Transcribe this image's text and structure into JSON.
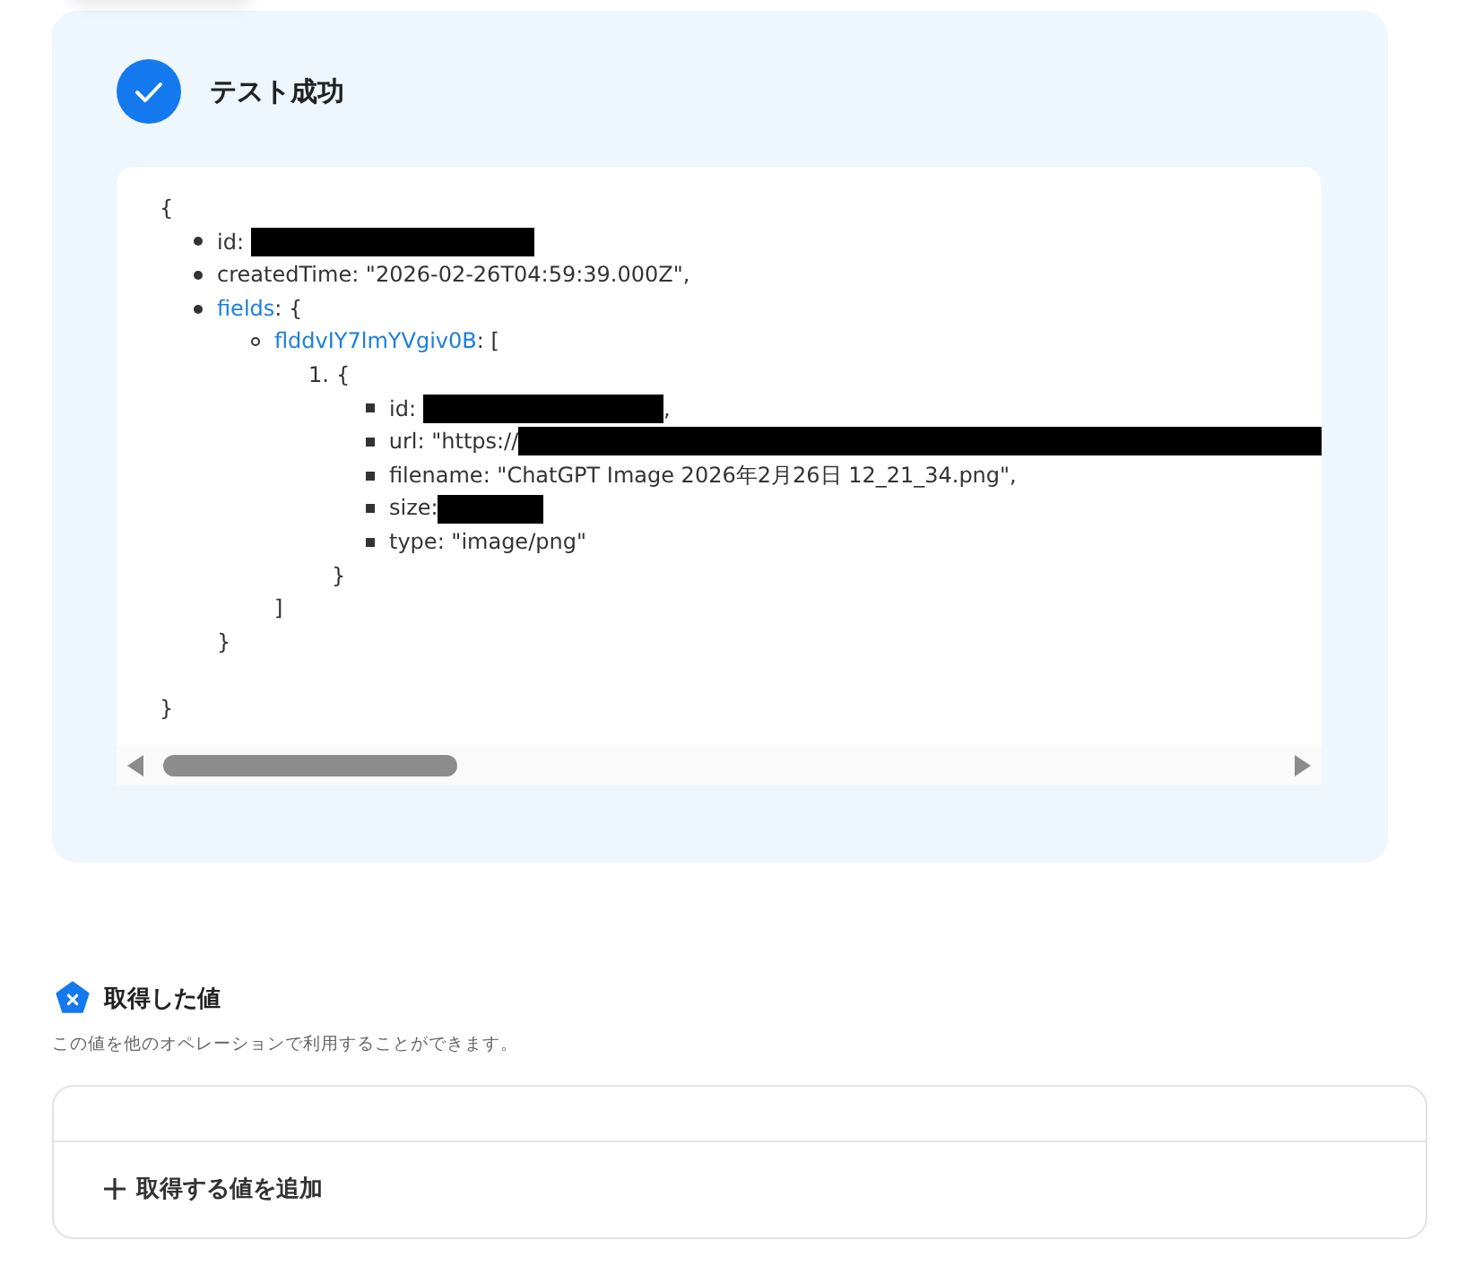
{
  "result": {
    "status": "テスト成功",
    "open": "{",
    "close": "}",
    "list": {
      "kind": "disc",
      "items": [
        {
          "key": "id",
          "link": false,
          "value": ":",
          "kind": "masked"
        },
        {
          "key": "createdTime",
          "link": false,
          "value": ": \"2026-02-26T04:59:39.000Z\","
        },
        {
          "key": "fields",
          "link": true,
          "value": ": {",
          "close": "}",
          "list": {
            "kind": "circle",
            "items": [
              {
                "key": "flddvIY7lmYVgiv0B",
                "link": true,
                "value": ": [",
                "close": "]",
                "list": {
                  "kind": "decimal",
                  "items": [
                    {
                      "number": "1.",
                      "value": "{",
                      "close": "}",
                      "list": {
                        "kind": "square",
                        "items": [
                          {
                            "key": "id",
                            "link": false,
                            "value": ":",
                            "kind": "masked",
                            "after": ","
                          },
                          {
                            "key": "url",
                            "link": false,
                            "value": ": \"https://",
                            "kind": "masked"
                          },
                          {
                            "key": "filename",
                            "link": false,
                            "value": ": \"ChatGPT Image 2026年2月26日 12_21_34.png\","
                          },
                          {
                            "key": "size",
                            "link": false,
                            "value": ":",
                            "kind": "masked"
                          },
                          {
                            "key": "type",
                            "link": false,
                            "value": ": \"image/png\""
                          }
                        ]
                      }
                    }
                  ]
                }
              }
            ]
          }
        }
      ]
    }
  },
  "values": {
    "title": "取得した値",
    "description": "この値を他のオペレーションで利用することができます。",
    "add_button": "取得する値を追加"
  }
}
